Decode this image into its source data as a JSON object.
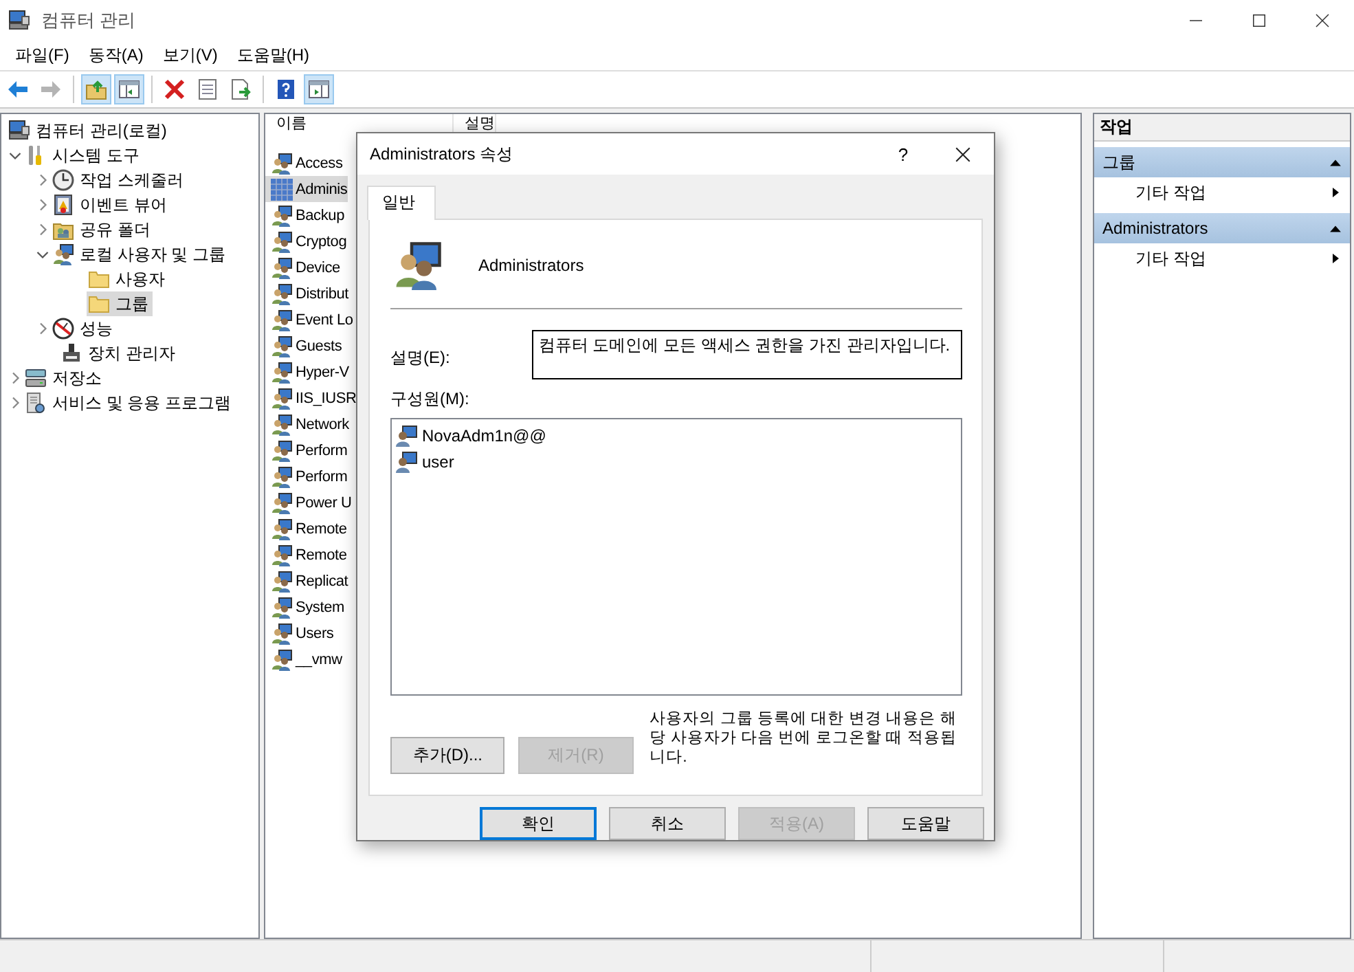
{
  "window": {
    "title": "컴퓨터 관리"
  },
  "menu": [
    "파일(F)",
    "동작(A)",
    "보기(V)",
    "도움말(H)"
  ],
  "toolbar": [
    {
      "pressed": false,
      "disabled": false
    },
    {
      "pressed": false,
      "disabled": true
    },
    {
      "pressed": true,
      "disabled": false
    },
    {
      "pressed": true,
      "disabled": false
    },
    {
      "pressed": false,
      "disabled": false
    },
    {
      "pressed": false,
      "disabled": false
    },
    {
      "pressed": false,
      "disabled": false
    },
    {
      "pressed": false,
      "disabled": false
    },
    {
      "pressed": true,
      "disabled": false
    }
  ],
  "tree": [
    {
      "label": "컴퓨터 관리(로컬)",
      "selected": false,
      "children": [
        {
          "label": "시스템 도구",
          "selected": false,
          "expanded": true,
          "children": [
            {
              "label": "작업 스케줄러",
              "selected": false,
              "expanded": false
            },
            {
              "label": "이벤트 뷰어",
              "selected": false,
              "expanded": false
            },
            {
              "label": "공유 폴더",
              "selected": false,
              "expanded": false
            },
            {
              "label": "로컬 사용자 및 그룹",
              "selected": false,
              "expanded": true,
              "children": [
                {
                  "label": "사용자",
                  "selected": false
                },
                {
                  "label": "그룹",
                  "selected": true
                }
              ]
            },
            {
              "label": "성능",
              "selected": false,
              "expanded": false
            },
            {
              "label": "장치 관리자",
              "selected": false
            }
          ]
        },
        {
          "label": "저장소",
          "selected": false,
          "expanded": false
        },
        {
          "label": "서비스 및 응용 프로그램",
          "selected": false,
          "expanded": false
        }
      ]
    }
  ],
  "list": {
    "columns": [
      "이름",
      "설명"
    ],
    "rows": [
      {
        "name": "Access",
        "selected": false
      },
      {
        "name": "Adminis",
        "selected": true
      },
      {
        "name": "Backup",
        "selected": false
      },
      {
        "name": "Cryptog",
        "selected": false
      },
      {
        "name": "Device",
        "selected": false
      },
      {
        "name": "Distribut",
        "selected": false
      },
      {
        "name": "Event Lo",
        "selected": false
      },
      {
        "name": "Guests",
        "selected": false
      },
      {
        "name": "Hyper-V",
        "selected": false
      },
      {
        "name": "IIS_IUSR",
        "selected": false
      },
      {
        "name": "Network",
        "selected": false
      },
      {
        "name": "Perform",
        "selected": false
      },
      {
        "name": "Perform",
        "selected": false
      },
      {
        "name": "Power U",
        "selected": false
      },
      {
        "name": "Remote",
        "selected": false
      },
      {
        "name": "Remote",
        "selected": false
      },
      {
        "name": "Replicat",
        "selected": false
      },
      {
        "name": "System",
        "selected": false
      },
      {
        "name": "Users",
        "selected": false
      },
      {
        "name": "__vmw",
        "selected": false
      }
    ]
  },
  "actions": {
    "title": "작업",
    "sections": [
      {
        "title": "그룹",
        "expanded": true,
        "items": [
          "기타 작업"
        ]
      },
      {
        "title": "Administrators",
        "expanded": true,
        "items": [
          "기타 작업"
        ]
      }
    ]
  },
  "dialog": {
    "title": "Administrators 속성",
    "help": "?",
    "tabs": [
      {
        "label": "일반",
        "selected": true
      }
    ],
    "group_name": "Administrators",
    "description_label": "설명(E):",
    "description": "컴퓨터 도메인에 모든 액세스 권한을 가진 관리자입니다.",
    "members_label": "구성원(M):",
    "members": [
      "NovaAdm1n@@",
      "user"
    ],
    "member_buttons": [
      {
        "label": "추가(D)...",
        "disabled": false
      },
      {
        "label": "제거(R)",
        "disabled": true
      }
    ],
    "note": "사용자의 그룹 등록에 대한 변경 내용은 해당 사용자가 다음 번에 로그온할 때 적용됩니다.",
    "buttons": [
      {
        "label": "확인",
        "disabled": false,
        "default": true
      },
      {
        "label": "취소",
        "disabled": false,
        "default": false
      },
      {
        "label": "적용(A)",
        "disabled": true,
        "default": false
      },
      {
        "label": "도움말",
        "disabled": false,
        "default": false
      }
    ]
  }
}
